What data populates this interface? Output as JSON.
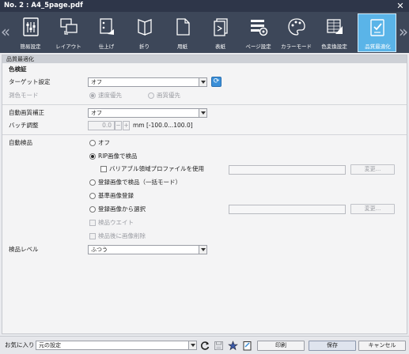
{
  "window": {
    "title": "No. 2 : A4_5page.pdf"
  },
  "toolbar": {
    "items": [
      {
        "label": "簡易設定"
      },
      {
        "label": "レイアウト"
      },
      {
        "label": "仕上げ"
      },
      {
        "label": "折り"
      },
      {
        "label": "用紙"
      },
      {
        "label": "表紙"
      },
      {
        "label": "ページ設定"
      },
      {
        "label": "カラーモード"
      },
      {
        "label": "色変換設定"
      },
      {
        "label": "品質最適化",
        "active": true
      }
    ]
  },
  "section": {
    "title": "品質最適化"
  },
  "color_verification": {
    "heading": "色検証",
    "target_label": "ターゲット設定",
    "target_value": "オフ",
    "mode_label": "測色モード",
    "mode_options": [
      "速度優先",
      "画質優先"
    ],
    "mode_selected": "速度優先"
  },
  "auto_quality": {
    "label": "自動画質補正",
    "value": "オフ",
    "batch_label": "バッチ調整",
    "batch_value": "0.0",
    "minus": "−",
    "plus": "+",
    "range_text": "mm [-100.0...100.0]"
  },
  "auto_inspection": {
    "label": "自動検品",
    "options": [
      {
        "label": "オフ",
        "selected": false
      },
      {
        "label": "RIP画像で検品",
        "selected": true
      },
      {
        "label": "登録画像で検品（一括モード）",
        "selected": false
      },
      {
        "label": "基準画像登録",
        "selected": false
      },
      {
        "label": "登録画像から選択",
        "selected": false
      }
    ],
    "variable_profile_label": "バリアブル領域プロファイルを使用",
    "change_button": "変更...",
    "wait_label": "検品ウエイト",
    "delete_label": "検品後に画像削除"
  },
  "inspection_level": {
    "label": "検品レベル",
    "value": "ふつう"
  },
  "footer": {
    "favorites_label": "お気に入り",
    "favorites_value": "元の設定",
    "print_button": "印刷",
    "save_button": "保存",
    "cancel_button": "キャンセル"
  },
  "colors": {
    "titlebar": "#2e3649",
    "toolbar": "#3d4759",
    "active_tab": "#5ab4e8",
    "accent_button": "#3a8fd8"
  }
}
